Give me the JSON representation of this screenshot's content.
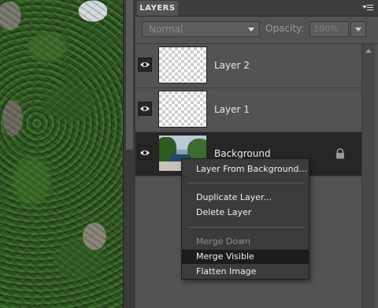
{
  "panel": {
    "tab_label": "LAYERS",
    "blend_mode": "Normal",
    "opacity_label": "Opacity:",
    "opacity_value": "100%"
  },
  "layers": [
    {
      "name": "Layer 2",
      "thumbnail": "transparent",
      "visible": true
    },
    {
      "name": "Layer 1",
      "thumbnail": "transparent",
      "visible": true
    },
    {
      "name": "Background",
      "thumbnail": "photo",
      "visible": true,
      "locked": true,
      "selected": true
    }
  ],
  "context_menu": {
    "items": [
      {
        "label": "Layer From Background...",
        "enabled": true
      },
      {
        "label": "Duplicate Layer...",
        "enabled": true
      },
      {
        "label": "Delete Layer",
        "enabled": true
      },
      {
        "label": "Merge Down",
        "enabled": false
      },
      {
        "label": "Merge Visible",
        "enabled": true,
        "highlighted": true
      },
      {
        "label": "Flatten Image",
        "enabled": true
      }
    ]
  },
  "colors": {
    "panel_bg": "#535353",
    "selected_row": "#262626",
    "menu_bg": "#3b3b3b",
    "menu_highlight": "#1c1c1c"
  },
  "icons": [
    "eye-icon",
    "lock-icon",
    "panel-menu-icon",
    "chevron-down-icon",
    "scroll-up-icon"
  ]
}
